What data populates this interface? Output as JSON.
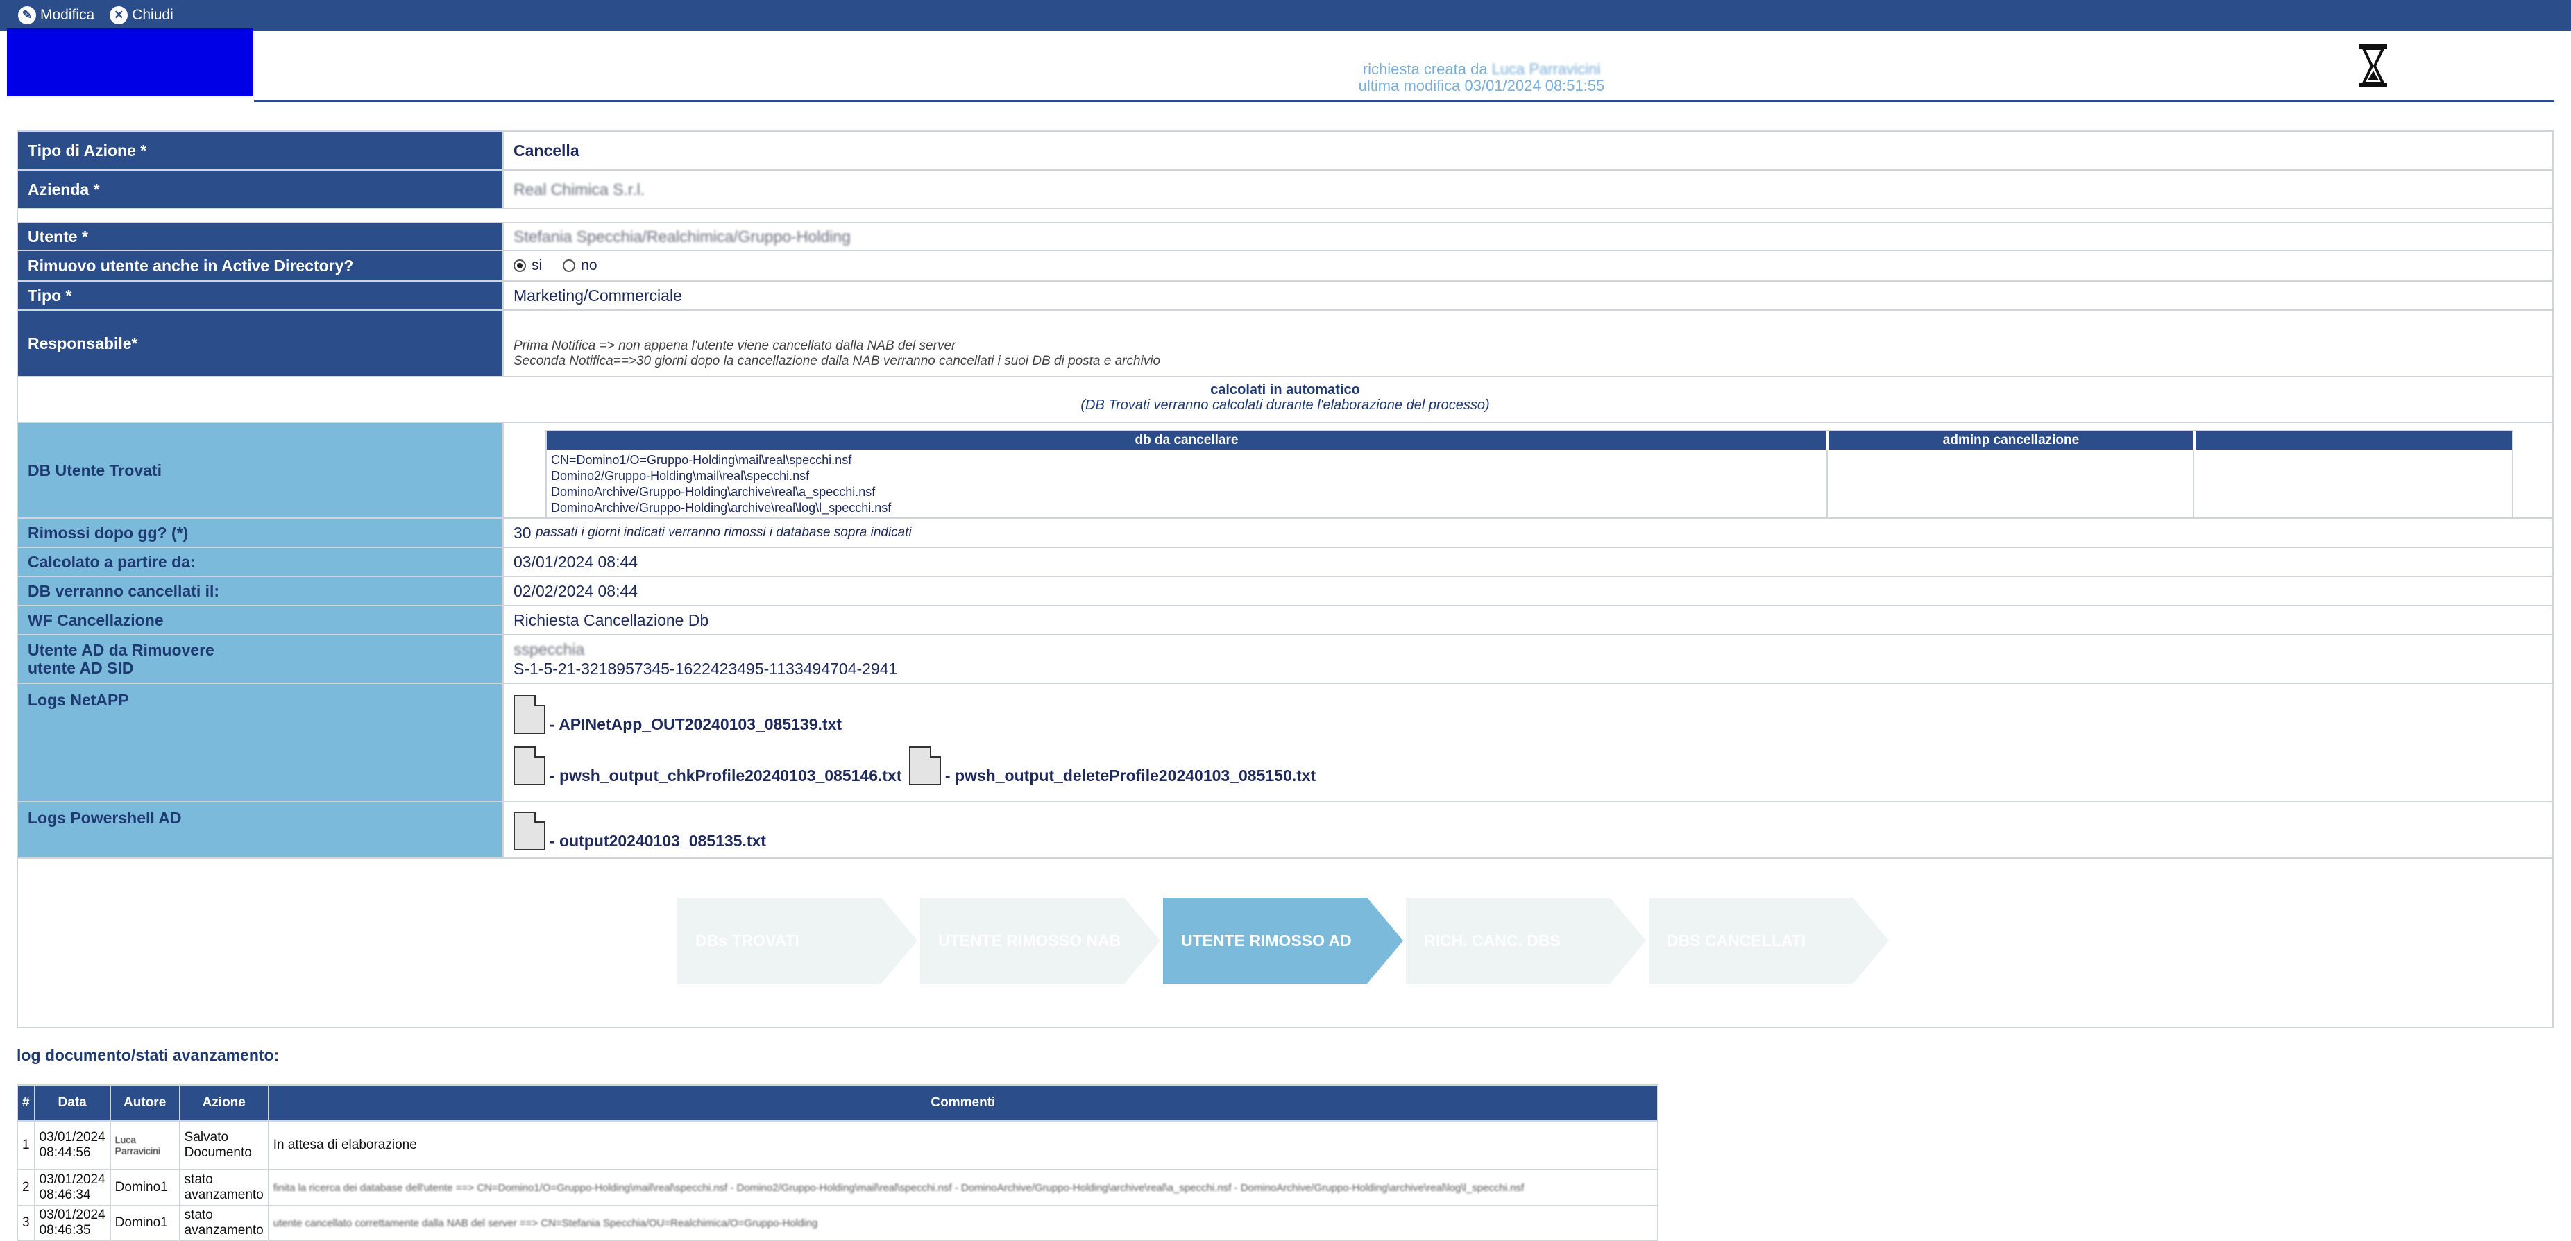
{
  "toolbar": {
    "edit_label": "Modifica",
    "close_label": "Chiudi"
  },
  "header": {
    "created_by_prefix": "richiesta creata da",
    "created_by_name": "Luca Parravicini",
    "last_modified": "ultima modifica 03/01/2024 08:51:55"
  },
  "form": {
    "tipo_azione": {
      "label": "Tipo di Azione *",
      "value": "Cancella"
    },
    "azienda": {
      "label": "Azienda *",
      "value": "Real Chimica S.r.l."
    },
    "utente": {
      "label": "Utente *",
      "value": "Stefania Specchia/Realchimica/Gruppo-Holding"
    },
    "rimuovo_ad": {
      "label": "Rimuovo utente anche in Active Directory?",
      "opt_si": "si",
      "opt_no": "no",
      "selected": "si"
    },
    "tipo": {
      "label": "Tipo *",
      "value": "Marketing/Commerciale"
    },
    "responsabile": {
      "label": "Responsabile*",
      "note1": "Prima Notifica => non appena l'utente viene cancellato dalla NAB del server",
      "note2": "Seconda Notifica==>30 giorni dopo la cancellazione dalla NAB verranno cancellati i suoi DB di posta e archivio"
    },
    "calcolati": {
      "title": "calcolati in automatico",
      "subtitle": "(DB Trovati  verranno calcolati durante l'elaborazione del processo)"
    },
    "db_trovati": {
      "label": "DB Utente Trovati",
      "col_db": "db da cancellare",
      "col_admin": "adminp cancellazione",
      "items": [
        "CN=Domino1/O=Gruppo-Holding\\mail\\real\\specchi.nsf",
        "Domino2/Gruppo-Holding\\mail\\real\\specchi.nsf",
        "DominoArchive/Gruppo-Holding\\archive\\real\\a_specchi.nsf",
        "DominoArchive/Gruppo-Holding\\archive\\real\\log\\l_specchi.nsf"
      ]
    },
    "rimossi_dopo": {
      "label": "Rimossi dopo gg? (*)",
      "value": "30",
      "note": "passati i giorni indicati verranno rimossi i database sopra indicati"
    },
    "calcolato_da": {
      "label": "Calcolato a partire da:",
      "value": "03/01/2024 08:44"
    },
    "db_cancellati_il": {
      "label": "DB verranno cancellati il:",
      "value": "02/02/2024 08:44"
    },
    "wf_cancellazione": {
      "label": "WF Cancellazione",
      "value": "Richiesta Cancellazione Db"
    },
    "utente_ad": {
      "label1": "Utente AD da Rimuovere",
      "label2": "utente AD SID",
      "value1": "sspecchia",
      "value2": "S-1-5-21-3218957345-1622423495-1133494704-2941"
    },
    "logs_netapp": {
      "label": "Logs NetAPP",
      "files": [
        "- APINetApp_OUT20240103_085139.txt",
        "- pwsh_output_chkProfile20240103_085146.txt",
        "- pwsh_output_deleteProfile20240103_085150.txt"
      ]
    },
    "logs_powershell": {
      "label": "Logs Powershell AD",
      "files": [
        "- output20240103_085135.txt"
      ]
    }
  },
  "steps": [
    {
      "label": "DBs TROVATI",
      "active": false
    },
    {
      "label": "UTENTE RIMOSSO NAB",
      "active": false
    },
    {
      "label": "UTENTE RIMOSSO AD",
      "active": true
    },
    {
      "label": "RICH. CANC. DBS",
      "active": false
    },
    {
      "label": "DBS CANCELLATI",
      "active": false
    }
  ],
  "log": {
    "title": "log documento/stati avanzamento:",
    "headers": [
      "#",
      "Data",
      "Autore",
      "Azione",
      "Commenti"
    ],
    "rows": [
      {
        "n": "1",
        "data": "03/01/2024 08:44:56",
        "autore": "Luca Parravicini",
        "azione": "Salvato Documento",
        "commento": "In attesa di elaborazione"
      },
      {
        "n": "2",
        "data": "03/01/2024 08:46:34",
        "autore": "Domino1",
        "azione": "stato avanzamento",
        "commento": "finita la ricerca dei database dell'utente ==> CN=Domino1/O=Gruppo-Holding\\mail\\real\\specchi.nsf - Domino2/Gruppo-Holding\\mail\\real\\specchi.nsf - DominoArchive/Gruppo-Holding\\archive\\real\\a_specchi.nsf - DominoArchive/Gruppo-Holding\\archive\\real\\log\\l_specchi.nsf"
      },
      {
        "n": "3",
        "data": "03/01/2024 08:46:35",
        "autore": "Domino1",
        "azione": "stato avanzamento",
        "commento": "utente cancellato correttamente dalla NAB del server ==> CN=Stefania Specchia/OU=Realchimica/O=Gruppo-Holding"
      }
    ]
  }
}
